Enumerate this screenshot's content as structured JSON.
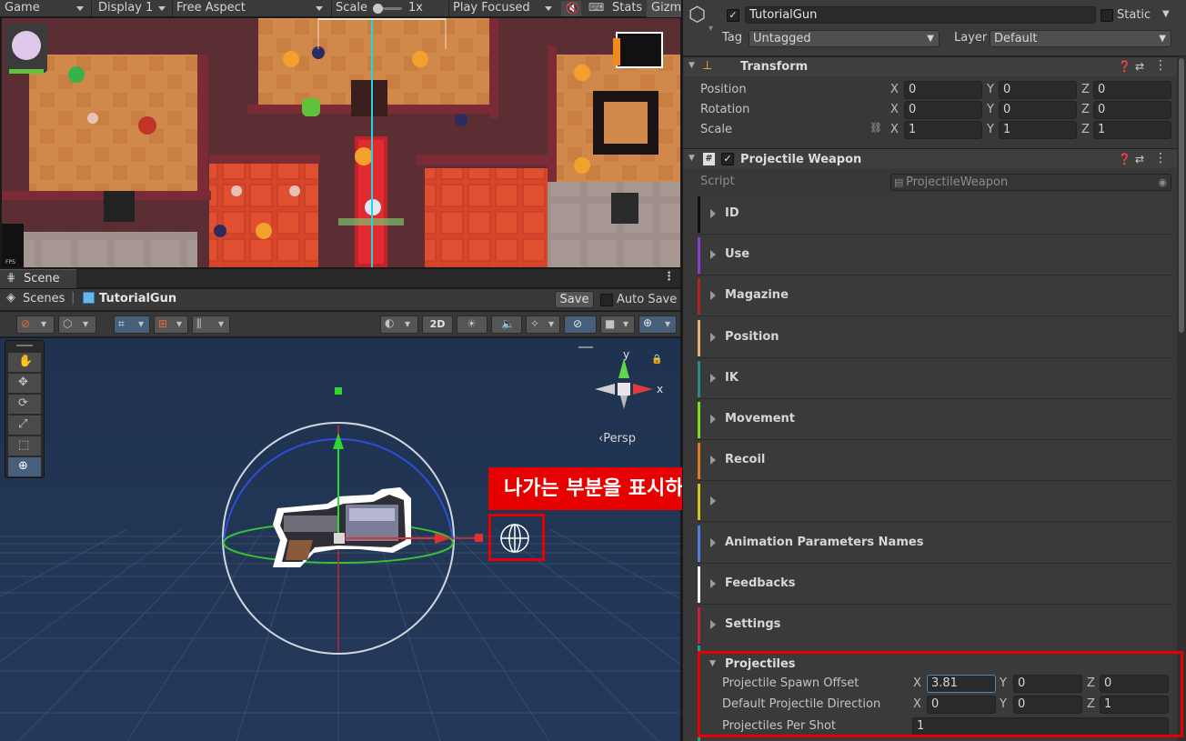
{
  "game_toolbar": {
    "tab": "Game",
    "display": "Display 1",
    "aspect": "Free Aspect",
    "scale_label": "Scale",
    "scale_value": "1x",
    "play_mode": "Play Focused",
    "stats": "Stats",
    "gizmos": "Gizm"
  },
  "game_view": {
    "fps_label": "FPS"
  },
  "scene": {
    "tab": "Scene",
    "breadcrumb_root": "Scenes",
    "breadcrumb_object": "TutorialGun",
    "save_button": "Save",
    "auto_save": "Auto Save",
    "mode_2d": "2D",
    "axis_y": "y",
    "axis_x": "x",
    "projection": "‹Persp",
    "annotation": "나가는 부분을 표시하는 Gizmo",
    "annotation_color": "#e60000"
  },
  "inspector": {
    "object_name": "TutorialGun",
    "static_label": "Static",
    "tag_label": "Tag",
    "tag_value": "Untagged",
    "layer_label": "Layer",
    "layer_value": "Default",
    "transform": {
      "title": "Transform",
      "rows": [
        {
          "label": "Position",
          "x": "0",
          "y": "0",
          "z": "0"
        },
        {
          "label": "Rotation",
          "x": "0",
          "y": "0",
          "z": "0"
        },
        {
          "label": "Scale",
          "x": "1",
          "y": "1",
          "z": "1"
        }
      ]
    },
    "component": {
      "title": "Projectile Weapon",
      "script_label": "Script",
      "script_value": "ProjectileWeapon"
    },
    "sections": [
      {
        "label": "ID",
        "color": "#111111"
      },
      {
        "label": "Use",
        "color": "#8a3fd1"
      },
      {
        "label": "Magazine",
        "color": "#b02424"
      },
      {
        "label": "Position",
        "color": "#e8b070"
      },
      {
        "label": "IK",
        "color": "#2a8a8a"
      },
      {
        "label": "Movement",
        "color": "#7cdc1e"
      },
      {
        "label": "Recoil",
        "color": "#e07a1e"
      },
      {
        "label": "",
        "color": "#d6c21e"
      },
      {
        "label": "Animation Parameters Names",
        "color": "#4e7ce0"
      },
      {
        "label": "Feedbacks",
        "color": "#f2f2f2"
      },
      {
        "label": "Settings",
        "color": "#c8203c"
      }
    ],
    "projectiles": {
      "title": "Projectiles",
      "color": "#1aa58a",
      "rows": [
        {
          "label": "Projectile Spawn Offset",
          "x": "3.81",
          "y": "0",
          "z": "0"
        },
        {
          "label": "Default Projectile Direction",
          "x": "0",
          "y": "0",
          "z": "1"
        }
      ],
      "per_shot_label": "Projectiles Per Shot",
      "per_shot_value": "1"
    },
    "axis_labels": [
      "X",
      "Y",
      "Z"
    ]
  }
}
